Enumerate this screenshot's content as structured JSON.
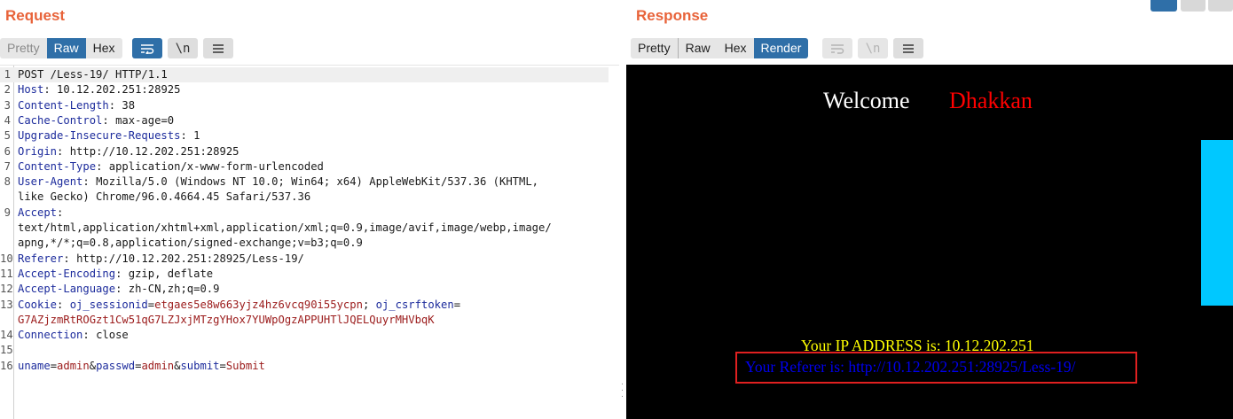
{
  "request": {
    "title": "Request",
    "tabs": [
      "Pretty",
      "Raw",
      "Hex"
    ],
    "active_tab": "Raw",
    "icons": [
      "wrap-lines-icon",
      "newline-icon",
      "menu-icon"
    ],
    "lines": [
      {
        "n": "1",
        "key": "",
        "sep": "",
        "val": "POST /Less-19/ HTTP/1.1"
      },
      {
        "n": "2",
        "key": "Host",
        "sep": ": ",
        "val": "10.12.202.251:28925"
      },
      {
        "n": "3",
        "key": "Content-Length",
        "sep": ": ",
        "val": "38"
      },
      {
        "n": "4",
        "key": "Cache-Control",
        "sep": ": ",
        "val": "max-age=0"
      },
      {
        "n": "5",
        "key": "Upgrade-Insecure-Requests",
        "sep": ": ",
        "val": "1"
      },
      {
        "n": "6",
        "key": "Origin",
        "sep": ": ",
        "val": "http://10.12.202.251:28925"
      },
      {
        "n": "7",
        "key": "Content-Type",
        "sep": ": ",
        "val": "application/x-www-form-urlencoded"
      },
      {
        "n": "8",
        "key": "User-Agent",
        "sep": ": ",
        "val": "Mozilla/5.0 (Windows NT 10.0; Win64; x64) AppleWebKit/537.36 (KHTML,"
      },
      {
        "n": "",
        "key": "",
        "sep": "",
        "val": "like Gecko) Chrome/96.0.4664.45 Safari/537.36"
      },
      {
        "n": "9",
        "key": "Accept",
        "sep": ":",
        "val": ""
      },
      {
        "n": "",
        "key": "",
        "sep": "",
        "val": "text/html,application/xhtml+xml,application/xml;q=0.9,image/avif,image/webp,image/"
      },
      {
        "n": "",
        "key": "",
        "sep": "",
        "val": "apng,*/*;q=0.8,application/signed-exchange;v=b3;q=0.9"
      },
      {
        "n": "10",
        "key": "Referer",
        "sep": ": ",
        "val": "http://10.12.202.251:28925/Less-19/"
      },
      {
        "n": "11",
        "key": "Accept-Encoding",
        "sep": ": ",
        "val": "gzip, deflate"
      },
      {
        "n": "12",
        "key": "Accept-Language",
        "sep": ": ",
        "val": "zh-CN,zh;q=0.9"
      }
    ],
    "cookie_line": {
      "n": "13",
      "key": "Cookie",
      "c1_name": "oj_sessionid",
      "c1_value": "etgaes5e8w663yjz4hz6vcq90i55ycpn",
      "c2_name": "oj_csrftoken",
      "c2_value": "G7AZjzmRtROGzt1Cw51qG7LZJxjMTzgYHox7YUWpOgzAPPUHTlJQELQuyrMHVbqK"
    },
    "connection_line": {
      "n": "14",
      "key": "Connection",
      "val": "close"
    },
    "blank_line": {
      "n": "15"
    },
    "body_line": {
      "n": "16",
      "p1_name": "uname",
      "p1_value": "admin",
      "p2_name": "passwd",
      "p2_value": "admin",
      "p3_name": "submit",
      "p3_value": "Submit"
    }
  },
  "response": {
    "title": "Response",
    "tabs": [
      "Pretty",
      "Raw",
      "Hex",
      "Render"
    ],
    "active_tab": "Render",
    "render": {
      "welcome": "Welcome",
      "name": "Dhakkan",
      "ip_line": "Your IP ADDRESS is: 10.12.202.251",
      "referer_line": "Your Referer is: http://10.12.202.251:28925/Less-19/"
    }
  },
  "colors": {
    "accent": "#e8633a",
    "active_tab": "#2f6fa8",
    "header_key": "#1c2b9c",
    "param_value": "#9b1b1b",
    "highlight_box": "#e02020",
    "scroll_thumb": "#00c8ff"
  }
}
